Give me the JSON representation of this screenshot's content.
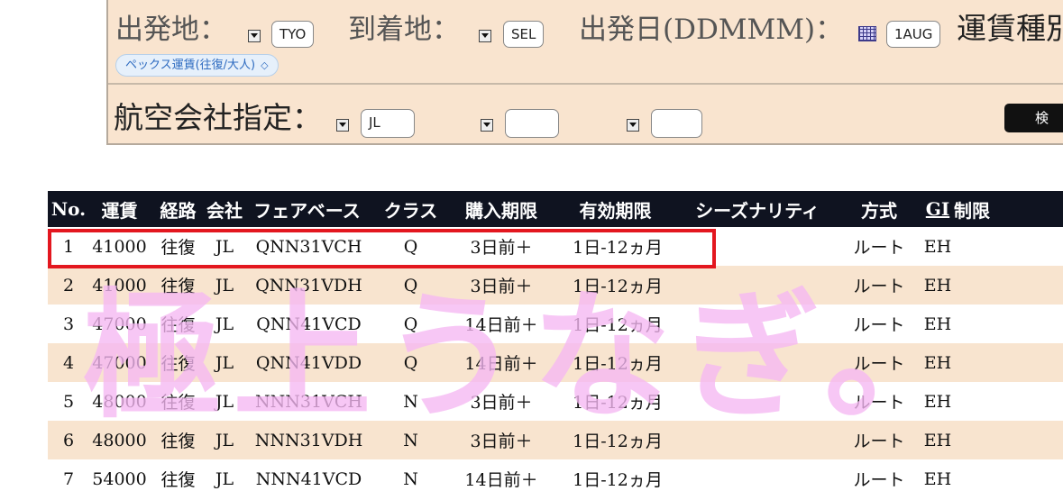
{
  "search": {
    "origin_label": "出発地：",
    "origin_value": "TYO",
    "destination_label": "到着地：",
    "destination_value": "SEL",
    "date_label": "出発日(DDMMM)：",
    "date_value": "1AUG",
    "fare_type_label": "運賃種別",
    "fare_type_value": "ペックス運賃(往復/大人)",
    "airline_label": "航空会社指定：",
    "airline_1": "JL",
    "airline_2": "",
    "airline_3": "",
    "search_button": "検"
  },
  "table": {
    "headers": [
      "No.",
      "運賃",
      "経路",
      "会社",
      "フェアベース",
      "クラス",
      "購入期限",
      "有効期限",
      "シーズナリティ",
      "方式",
      "GI",
      "制限"
    ],
    "rows": [
      {
        "no": "1",
        "fare": "41000",
        "route": "往復",
        "airline": "JL",
        "basis": "QNN31VCH",
        "cls": "Q",
        "purchase": "3日前＋",
        "validity": "1日-12ヵ月",
        "season": "",
        "method": "ルート",
        "gi": "EH",
        "restrict": ""
      },
      {
        "no": "2",
        "fare": "41000",
        "route": "往復",
        "airline": "JL",
        "basis": "QNN31VDH",
        "cls": "Q",
        "purchase": "3日前＋",
        "validity": "1日-12ヵ月",
        "season": "",
        "method": "ルート",
        "gi": "EH",
        "restrict": ""
      },
      {
        "no": "3",
        "fare": "47000",
        "route": "往復",
        "airline": "JL",
        "basis": "QNN41VCD",
        "cls": "Q",
        "purchase": "14日前＋",
        "validity": "1日-12ヵ月",
        "season": "",
        "method": "ルート",
        "gi": "EH",
        "restrict": ""
      },
      {
        "no": "4",
        "fare": "47000",
        "route": "往復",
        "airline": "JL",
        "basis": "QNN41VDD",
        "cls": "Q",
        "purchase": "14日前＋",
        "validity": "1日-12ヵ月",
        "season": "",
        "method": "ルート",
        "gi": "EH",
        "restrict": ""
      },
      {
        "no": "5",
        "fare": "48000",
        "route": "往復",
        "airline": "JL",
        "basis": "NNN31VCH",
        "cls": "N",
        "purchase": "3日前＋",
        "validity": "1日-12ヵ月",
        "season": "",
        "method": "ルート",
        "gi": "EH",
        "restrict": ""
      },
      {
        "no": "6",
        "fare": "48000",
        "route": "往復",
        "airline": "JL",
        "basis": "NNN31VDH",
        "cls": "N",
        "purchase": "3日前＋",
        "validity": "1日-12ヵ月",
        "season": "",
        "method": "ルート",
        "gi": "EH",
        "restrict": ""
      },
      {
        "no": "7",
        "fare": "54000",
        "route": "往復",
        "airline": "JL",
        "basis": "NNN41VCD",
        "cls": "N",
        "purchase": "14日前＋",
        "validity": "1日-12ヵ月",
        "season": "",
        "method": "ルート",
        "gi": "EH",
        "restrict": ""
      }
    ]
  },
  "watermark": "極上うなぎ。",
  "colors": {
    "panel_bg": "#f9e4cf",
    "header_bg": "#0f1320",
    "stripe": "#f8e4cf",
    "highlight": "#e3171f",
    "watermark": "#f6b8f3"
  }
}
